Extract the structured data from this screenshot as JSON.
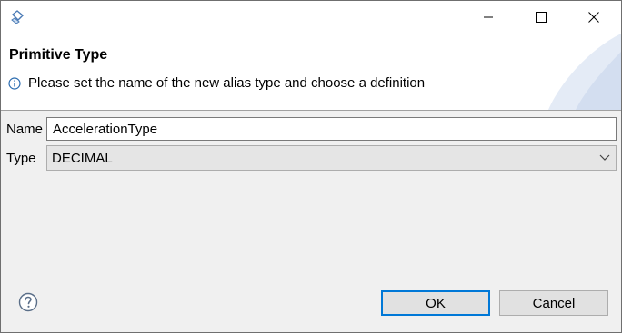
{
  "window": {
    "icon": "eclipse-dialog-icon",
    "controls": [
      "minimize-icon",
      "maximize-icon",
      "close-icon"
    ]
  },
  "banner": {
    "title": "Primitive Type",
    "message": "Please set the name of the new alias type and choose a definition",
    "message_icon": "info-icon"
  },
  "form": {
    "name_label": "Name",
    "name_value": "AccelerationType",
    "type_label": "Type",
    "type_value": "DECIMAL"
  },
  "footer": {
    "help_icon": "help-icon",
    "ok_label": "OK",
    "cancel_label": "Cancel"
  },
  "colors": {
    "accent": "#0078d7",
    "dialog_bg": "#f0f0f0",
    "banner_bg": "#ffffff"
  }
}
